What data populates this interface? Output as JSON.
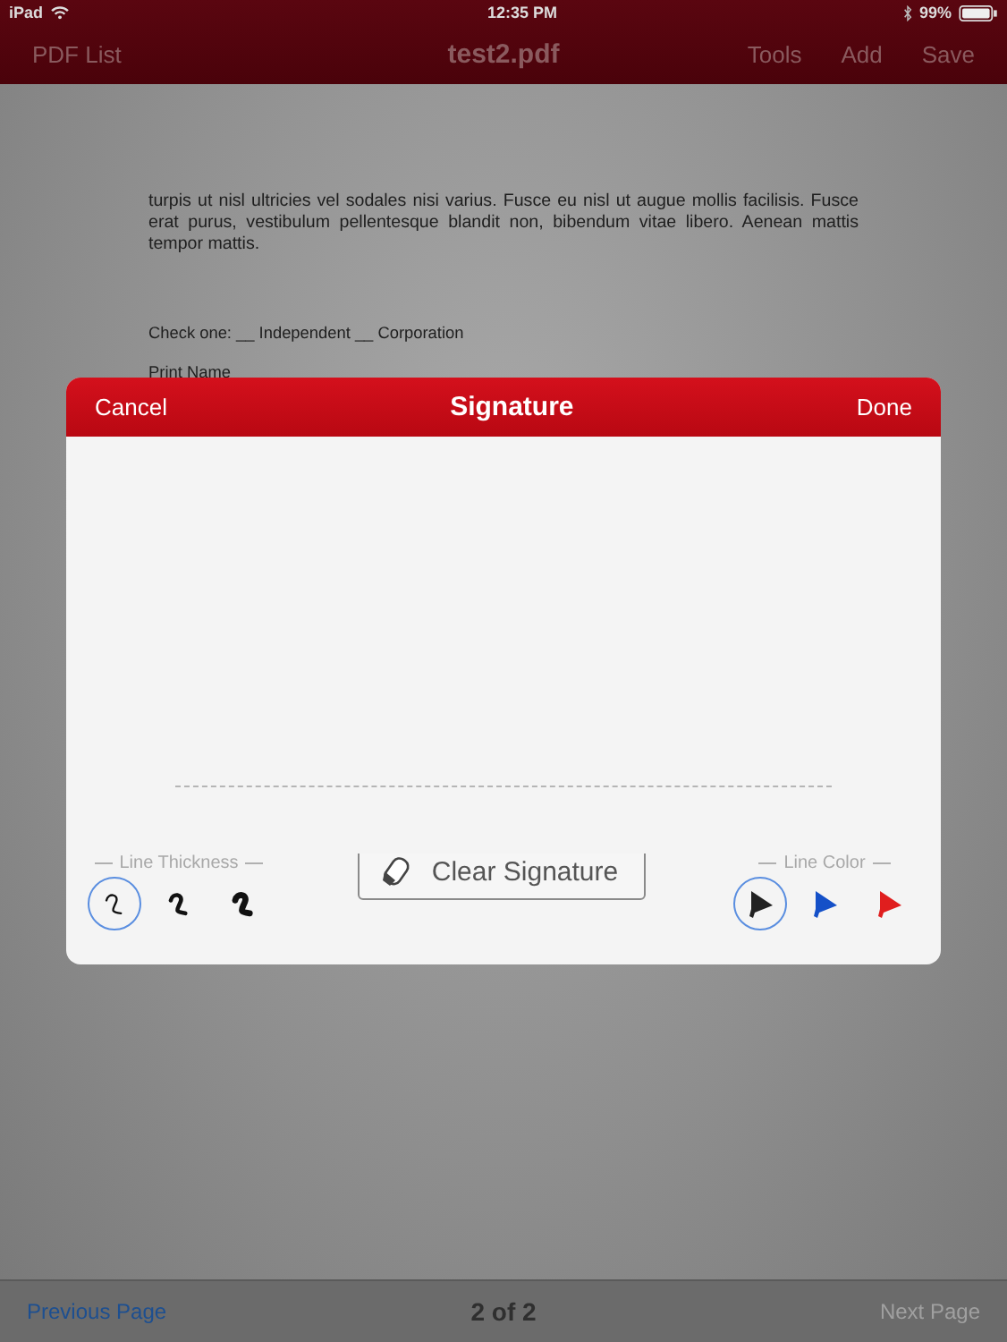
{
  "status_bar": {
    "device": "iPad",
    "time": "12:35 PM",
    "battery": "99%"
  },
  "nav_bar": {
    "back": "PDF List",
    "title": "test2.pdf",
    "actions": [
      "Tools",
      "Add",
      "Save"
    ]
  },
  "document": {
    "paragraph": "turpis ut nisl ultricies vel sodales nisi varius. Fusce eu nisl ut augue mollis facilisis. Fusce erat purus, vestibulum pellentesque blandit non, bibendum vitae libero. Aenean mattis tempor mattis.",
    "check_line": "Check one: __ Independent  __ Corporation",
    "print_name": "Print Name"
  },
  "signature_dialog": {
    "cancel": "Cancel",
    "title": "Signature",
    "done": "Done",
    "thickness_label": "Line Thickness",
    "thickness_options": [
      {
        "kind": "thin",
        "selected": true
      },
      {
        "kind": "medium",
        "selected": false
      },
      {
        "kind": "thick",
        "selected": false
      }
    ],
    "clear_button": "Clear Signature",
    "color_label": "Line Color",
    "color_options": [
      {
        "color": "#222222",
        "selected": true
      },
      {
        "color": "#1450c8",
        "selected": false
      },
      {
        "color": "#e01e1e",
        "selected": false
      }
    ]
  },
  "bottom_bar": {
    "previous": {
      "label": "Previous Page",
      "disabled": false
    },
    "page": "2 of 2",
    "next": {
      "label": "Next Page",
      "disabled": true
    }
  }
}
